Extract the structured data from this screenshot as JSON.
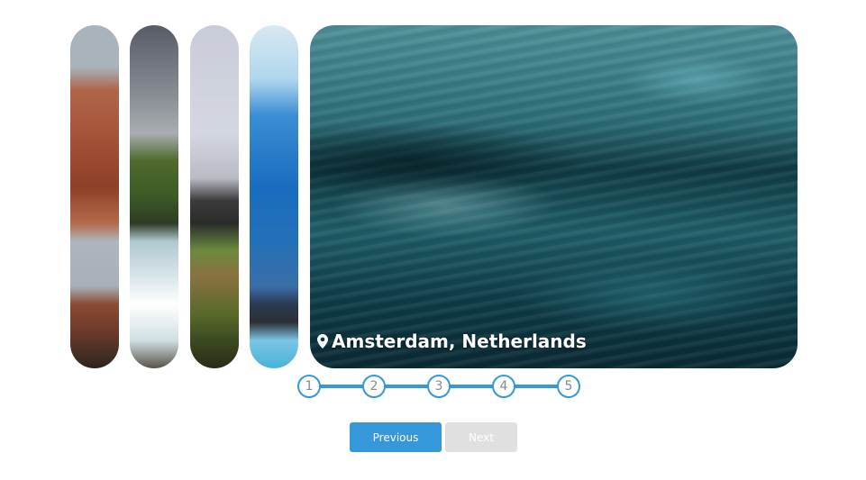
{
  "gallery": {
    "slides": [
      {
        "name": "slide-1-rock-arch"
      },
      {
        "name": "slide-2-waterfall"
      },
      {
        "name": "slide-3-mountains"
      },
      {
        "name": "slide-4-glacier"
      },
      {
        "name": "slide-5-ocean"
      }
    ],
    "active_caption": "Amsterdam, Netherlands",
    "caption_icon": "location-pin-icon"
  },
  "stepper": {
    "steps": [
      "1",
      "2",
      "3",
      "4",
      "5"
    ],
    "accent_color": "#3498db"
  },
  "buttons": {
    "previous_label": "Previous",
    "next_label": "Next"
  }
}
